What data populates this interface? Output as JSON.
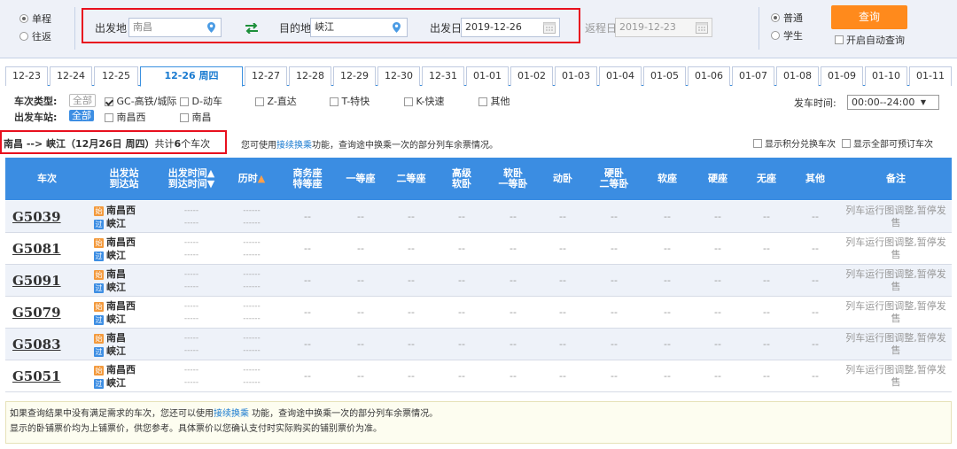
{
  "trip_type": {
    "one_way": "单程",
    "round_trip": "往返"
  },
  "from": {
    "label": "出发地",
    "value": "南昌"
  },
  "to": {
    "label": "目的地",
    "value": "峡江"
  },
  "depart_date": {
    "label": "出发日",
    "value": "2019-12-26"
  },
  "return_date": {
    "label": "返程日",
    "value": "2019-12-23"
  },
  "passenger_type": {
    "normal": "普通",
    "student": "学生"
  },
  "query_button": "查询",
  "auto_query": "开启自动查询",
  "date_tabs": [
    "12-23",
    "12-24",
    "12-25",
    "12-26 周四",
    "12-27",
    "12-28",
    "12-29",
    "12-30",
    "12-31",
    "01-01",
    "01-02",
    "01-03",
    "01-04",
    "01-05",
    "01-06",
    "01-07",
    "01-08",
    "01-09",
    "01-10",
    "01-11"
  ],
  "filters": {
    "train_type_label": "车次类型:",
    "all": "全部",
    "types": [
      "GC-高铁/城际",
      "D-动车",
      "Z-直达",
      "T-特快",
      "K-快速",
      "其他"
    ],
    "station_label": "出发车站:",
    "stations": [
      "南昌西",
      "南昌"
    ],
    "time_label": "发车时间:",
    "time_value": "00:00--24:00"
  },
  "summary": {
    "route": "南昌 --> 峡江（12月26日 周四）",
    "count_prefix": "共计",
    "count": "6",
    "count_suffix": "个车次"
  },
  "transfer_hint": {
    "pre": "您可使用",
    "link": "接续换乘",
    "post": "功能，查询途中换乘一次的部分列车余票情况。"
  },
  "options": {
    "points": "显示积分兑换车次",
    "all_bookable": "显示全部可预订车次"
  },
  "headers": {
    "train": "车次",
    "station_top": "出发站",
    "station_bottom": "到达站",
    "time_top": "出发时间▲",
    "time_bottom": "到达时间▼",
    "duration": "历时",
    "duration_arrow": "▲",
    "business_top": "商务座",
    "business_bottom": "特等座",
    "first": "一等座",
    "second": "二等座",
    "adv_sleeper_top": "高级",
    "adv_sleeper_bottom": "软卧",
    "soft_sleeper_top": "软卧",
    "soft_sleeper_bottom": "一等卧",
    "emu_sleeper": "动卧",
    "hard_sleeper_top": "硬卧",
    "hard_sleeper_bottom": "二等卧",
    "soft_seat": "软座",
    "hard_seat": "硬座",
    "no_seat": "无座",
    "other": "其他",
    "remark": "备注"
  },
  "trains": [
    {
      "no": "G5039",
      "from": "南昌西",
      "to": "峡江"
    },
    {
      "no": "G5081",
      "from": "南昌西",
      "to": "峡江"
    },
    {
      "no": "G5091",
      "from": "南昌",
      "to": "峡江"
    },
    {
      "no": "G5079",
      "from": "南昌西",
      "to": "峡江"
    },
    {
      "no": "G5083",
      "from": "南昌",
      "to": "峡江"
    },
    {
      "no": "G5051",
      "from": "南昌西",
      "to": "峡江"
    }
  ],
  "cell_placeholder": "--",
  "time_placeholder": "-----",
  "duration_placeholder": "------",
  "start_icon": "始",
  "pass_icon": "过",
  "remark_text": "列车运行图调整,暂停发售",
  "notice": {
    "line1_pre": "如果查询结果中没有满足需求的车次，您还可以使用",
    "line1_link": "接续换乘",
    "line1_post": " 功能，查询途中换乘一次的部分列车余票情况。",
    "line2": "显示的卧铺票价均为上铺票价，供您参考。具体票价以您确认支付时实际购买的铺别票价为准。"
  },
  "colors": {
    "accent": "#3b8de2",
    "highlight_box": "#e8101e",
    "query_button": "#ff8a1c"
  }
}
